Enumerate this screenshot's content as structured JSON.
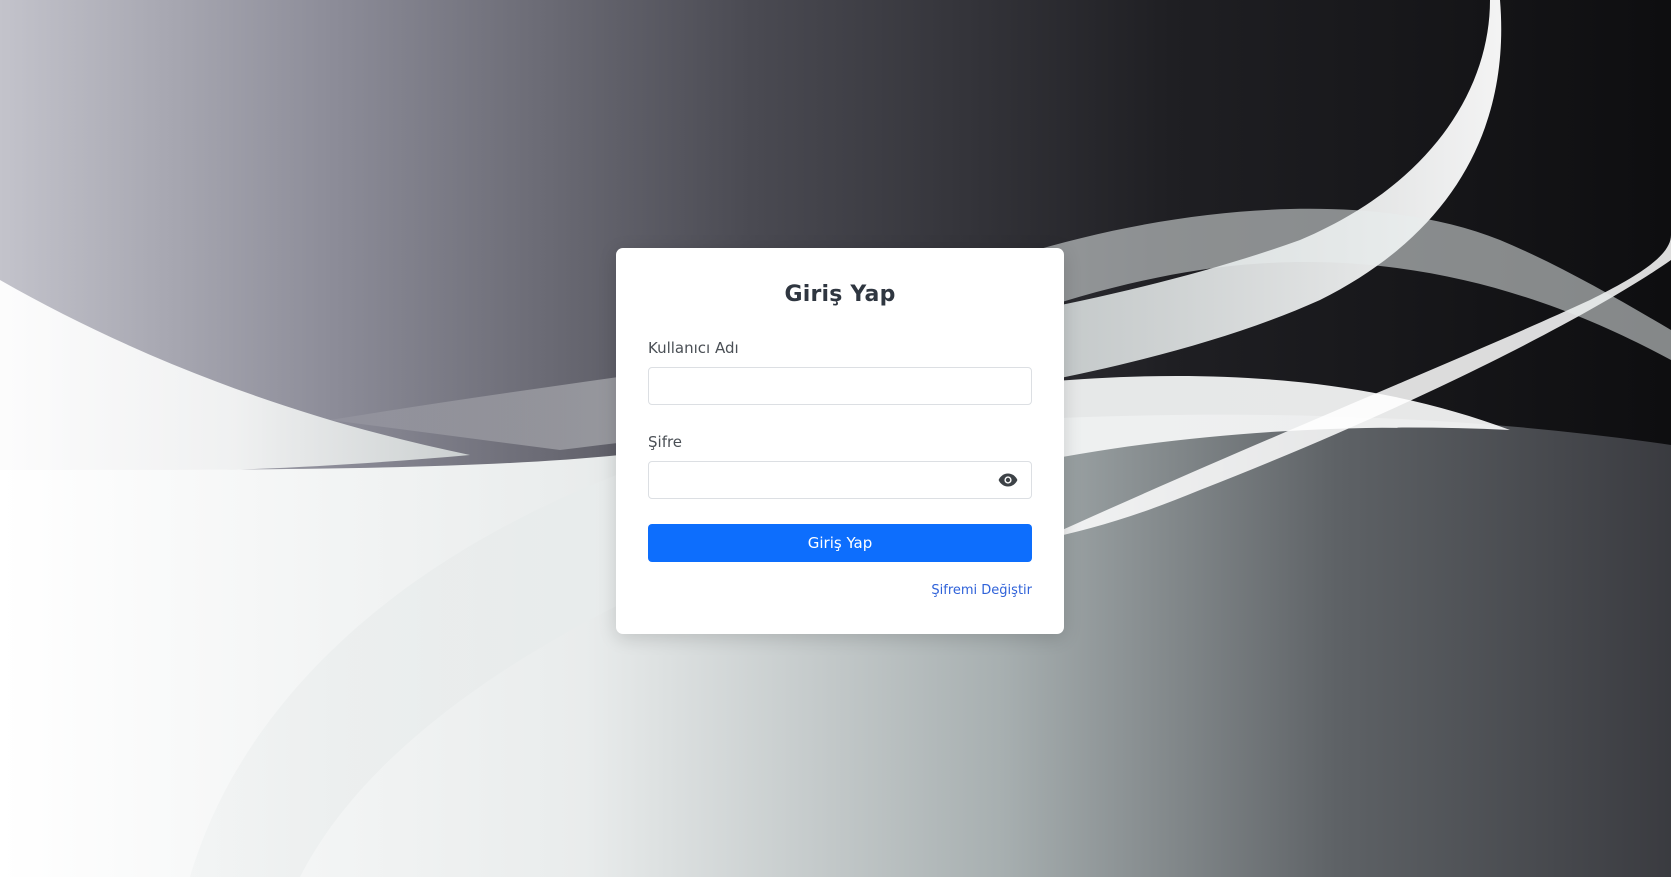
{
  "login": {
    "title": "Giriş Yap",
    "username_label": "Kullanıcı Adı",
    "username_value": "",
    "password_label": "Şifre",
    "password_value": "",
    "submit_label": "Giriş Yap",
    "change_password_link": "Şifremi Değiştir"
  },
  "colors": {
    "primary": "#0d6efd",
    "link": "#2f62d9",
    "title_text": "#2f3640",
    "card_background": "#ffffff"
  },
  "icons": {
    "password_toggle": "eye-icon"
  }
}
